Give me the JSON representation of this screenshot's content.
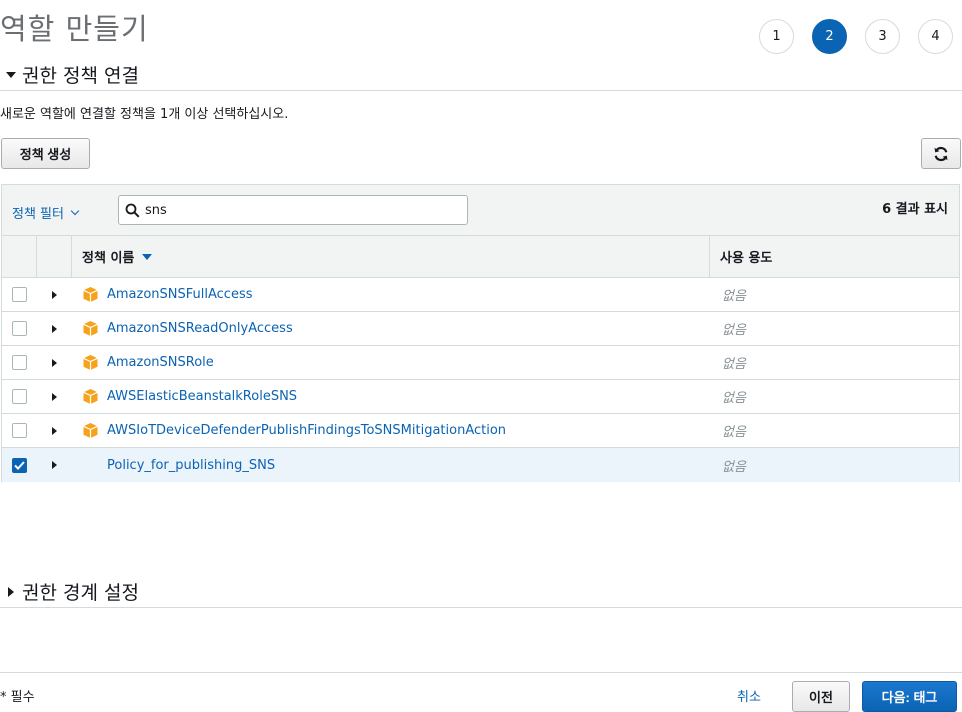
{
  "page": {
    "title": "역할 만들기"
  },
  "steps": [
    {
      "label": "1",
      "active": false
    },
    {
      "label": "2",
      "active": true
    },
    {
      "label": "3",
      "active": false
    },
    {
      "label": "4",
      "active": false
    }
  ],
  "permissions_section": {
    "title": "권한 정책 연결",
    "description": "새로운 역할에 연결할 정책을 1개 이상 선택하십시오.",
    "create_policy_label": "정책 생성"
  },
  "table": {
    "filter_label": "정책 필터",
    "search_value": "sns",
    "result_count": "6 결과 표시",
    "columns": {
      "name": "정책 이름",
      "usage": "사용 용도"
    },
    "rows": [
      {
        "name": "AmazonSNSFullAccess",
        "usage": "없음",
        "checked": false,
        "aws_managed": true
      },
      {
        "name": "AmazonSNSReadOnlyAccess",
        "usage": "없음",
        "checked": false,
        "aws_managed": true
      },
      {
        "name": "AmazonSNSRole",
        "usage": "없음",
        "checked": false,
        "aws_managed": true
      },
      {
        "name": "AWSElasticBeanstalkRoleSNS",
        "usage": "없음",
        "checked": false,
        "aws_managed": true
      },
      {
        "name": "AWSIoTDeviceDefenderPublishFindingsToSNSMitigationAction",
        "usage": "없음",
        "checked": false,
        "aws_managed": true
      },
      {
        "name": "Policy_for_publishing_SNS",
        "usage": "없음",
        "checked": true,
        "aws_managed": false
      }
    ]
  },
  "boundary_section": {
    "title": "권한 경계 설정"
  },
  "footer": {
    "required_note": "* 필수",
    "cancel_label": "취소",
    "prev_label": "이전",
    "next_label": "다음: 태그"
  },
  "colors": {
    "accent": "#0b63b3",
    "policy_icon": "#f7a21b",
    "selected_row": "#ebf3fb"
  }
}
